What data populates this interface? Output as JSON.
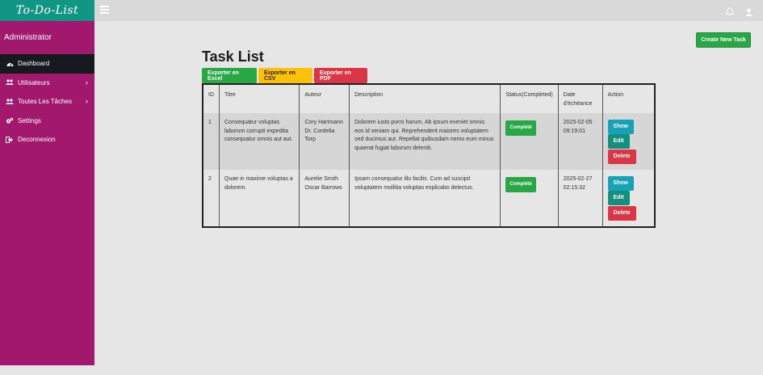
{
  "brand": {
    "title": "To-Do-List"
  },
  "sidebar": {
    "admin_name": "Administrator",
    "items": [
      {
        "label": "Dashboard",
        "icon": "dashboard-icon",
        "active": true
      },
      {
        "label": "Utilisateurs",
        "icon": "users-icon",
        "has_chevron": true
      },
      {
        "label": "Toutes Les Tâches",
        "icon": "users-icon",
        "has_chevron": true
      },
      {
        "label": "Settings",
        "icon": "gears-icon"
      },
      {
        "label": "Deconnexion",
        "icon": "sign-out-icon"
      }
    ],
    "colors": {
      "sidebar": "#a2186d",
      "brand": "#119683",
      "active": "#151a1f"
    }
  },
  "topbar": {
    "menu_icon": "hamburger-icon",
    "notification_icon": "bell-icon",
    "user_icon": "user-icon"
  },
  "main": {
    "create_button": "Create New Task",
    "title": "Task List",
    "exports": {
      "excel": "Exporter en Excel",
      "csv": "Exporter en CSV",
      "pdf": "Exporter en PDF"
    },
    "table": {
      "headers": [
        "ID",
        "Titre",
        "Auteur",
        "Description",
        "Status(Completed)",
        "Date d'échéance",
        "Action"
      ],
      "rows": [
        {
          "id": "1",
          "title": "Consequatur voluptas laborum corrupti expedita consequatur omnis aut aut.",
          "authors": [
            "Cory Hartmann",
            "Dr. Cordelia Torp"
          ],
          "description": "Dolorem iusto porro harum. Ab ipsum eveniet omnis eos id veniam qui. Reprehenderit maiores voluptatem sed ducimus aut. Repellat quibusdam nemo eum minus quaerat fugiat laborum deleniti.",
          "status": "Complété",
          "date": "2025-02-05",
          "time": "09:19:01",
          "actions": {
            "show": "Show",
            "edit": "Edit",
            "delete": "Delete"
          }
        },
        {
          "id": "2",
          "title": "Quae in maxime voluptas a dolorem.",
          "authors": [
            "Aurelie Smith",
            "Oscar Barrows"
          ],
          "description": "Ipsam consequatur illo facilis. Cum ad suscipit voluptatem mollitia voluptas explicabo delectus.",
          "status": "Complété",
          "date": "2025-02-27",
          "time": "02:15:32",
          "actions": {
            "show": "Show",
            "edit": "Edit",
            "delete": "Delete"
          }
        }
      ]
    }
  }
}
